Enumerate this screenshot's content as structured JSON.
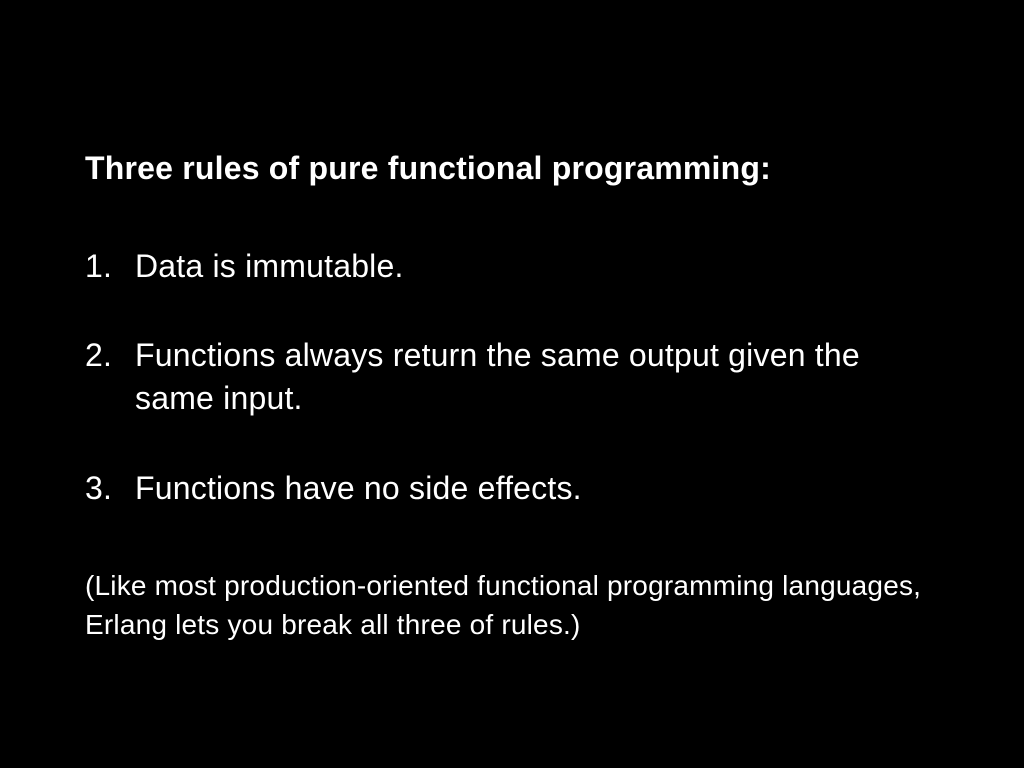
{
  "slide": {
    "heading": "Three rules of pure functional programming:",
    "rules": [
      "Data is immutable.",
      "Functions always return the same output given the same input.",
      "Functions have no side effects."
    ],
    "footnote": "(Like most production-oriented functional programming languages, Erlang lets you break all three of rules.)"
  }
}
